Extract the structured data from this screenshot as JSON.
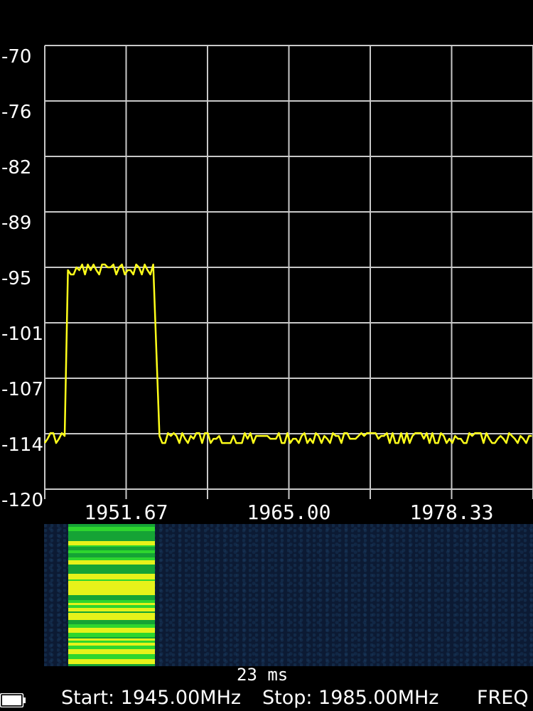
{
  "chart_data": {
    "type": "line",
    "y_ticks": [
      "-70",
      "-76",
      "-82",
      "-89",
      "-95",
      "-101",
      "-107",
      "-114",
      "-120"
    ],
    "x_ticks": [
      "1951.67",
      "1965.00",
      "1978.33"
    ],
    "x_range": [
      1945.0,
      1985.0
    ],
    "y_range": [
      -120,
      -70
    ],
    "grid": true,
    "series": [
      {
        "color": "#ffff1a",
        "segments": [
          {
            "x_start": 1945.0,
            "x_end": 1946.7,
            "level": -114
          },
          {
            "x_start": 1946.9,
            "x_end": 1954.0,
            "level": -95
          },
          {
            "x_start": 1954.4,
            "x_end": 1985.0,
            "level": -114
          }
        ]
      }
    ]
  },
  "waterfall": {
    "background_color": "#0c1a33",
    "signal_color": "#2ed62e",
    "signal_highlight": "#e6f21a"
  },
  "time_label": "23 ms",
  "status_bar": {
    "start_label": "Start: 1945.00MHz",
    "stop_label": "Stop: 1985.00MHz",
    "mode_label": "FREQ"
  },
  "icons": {
    "battery": "battery-icon"
  }
}
